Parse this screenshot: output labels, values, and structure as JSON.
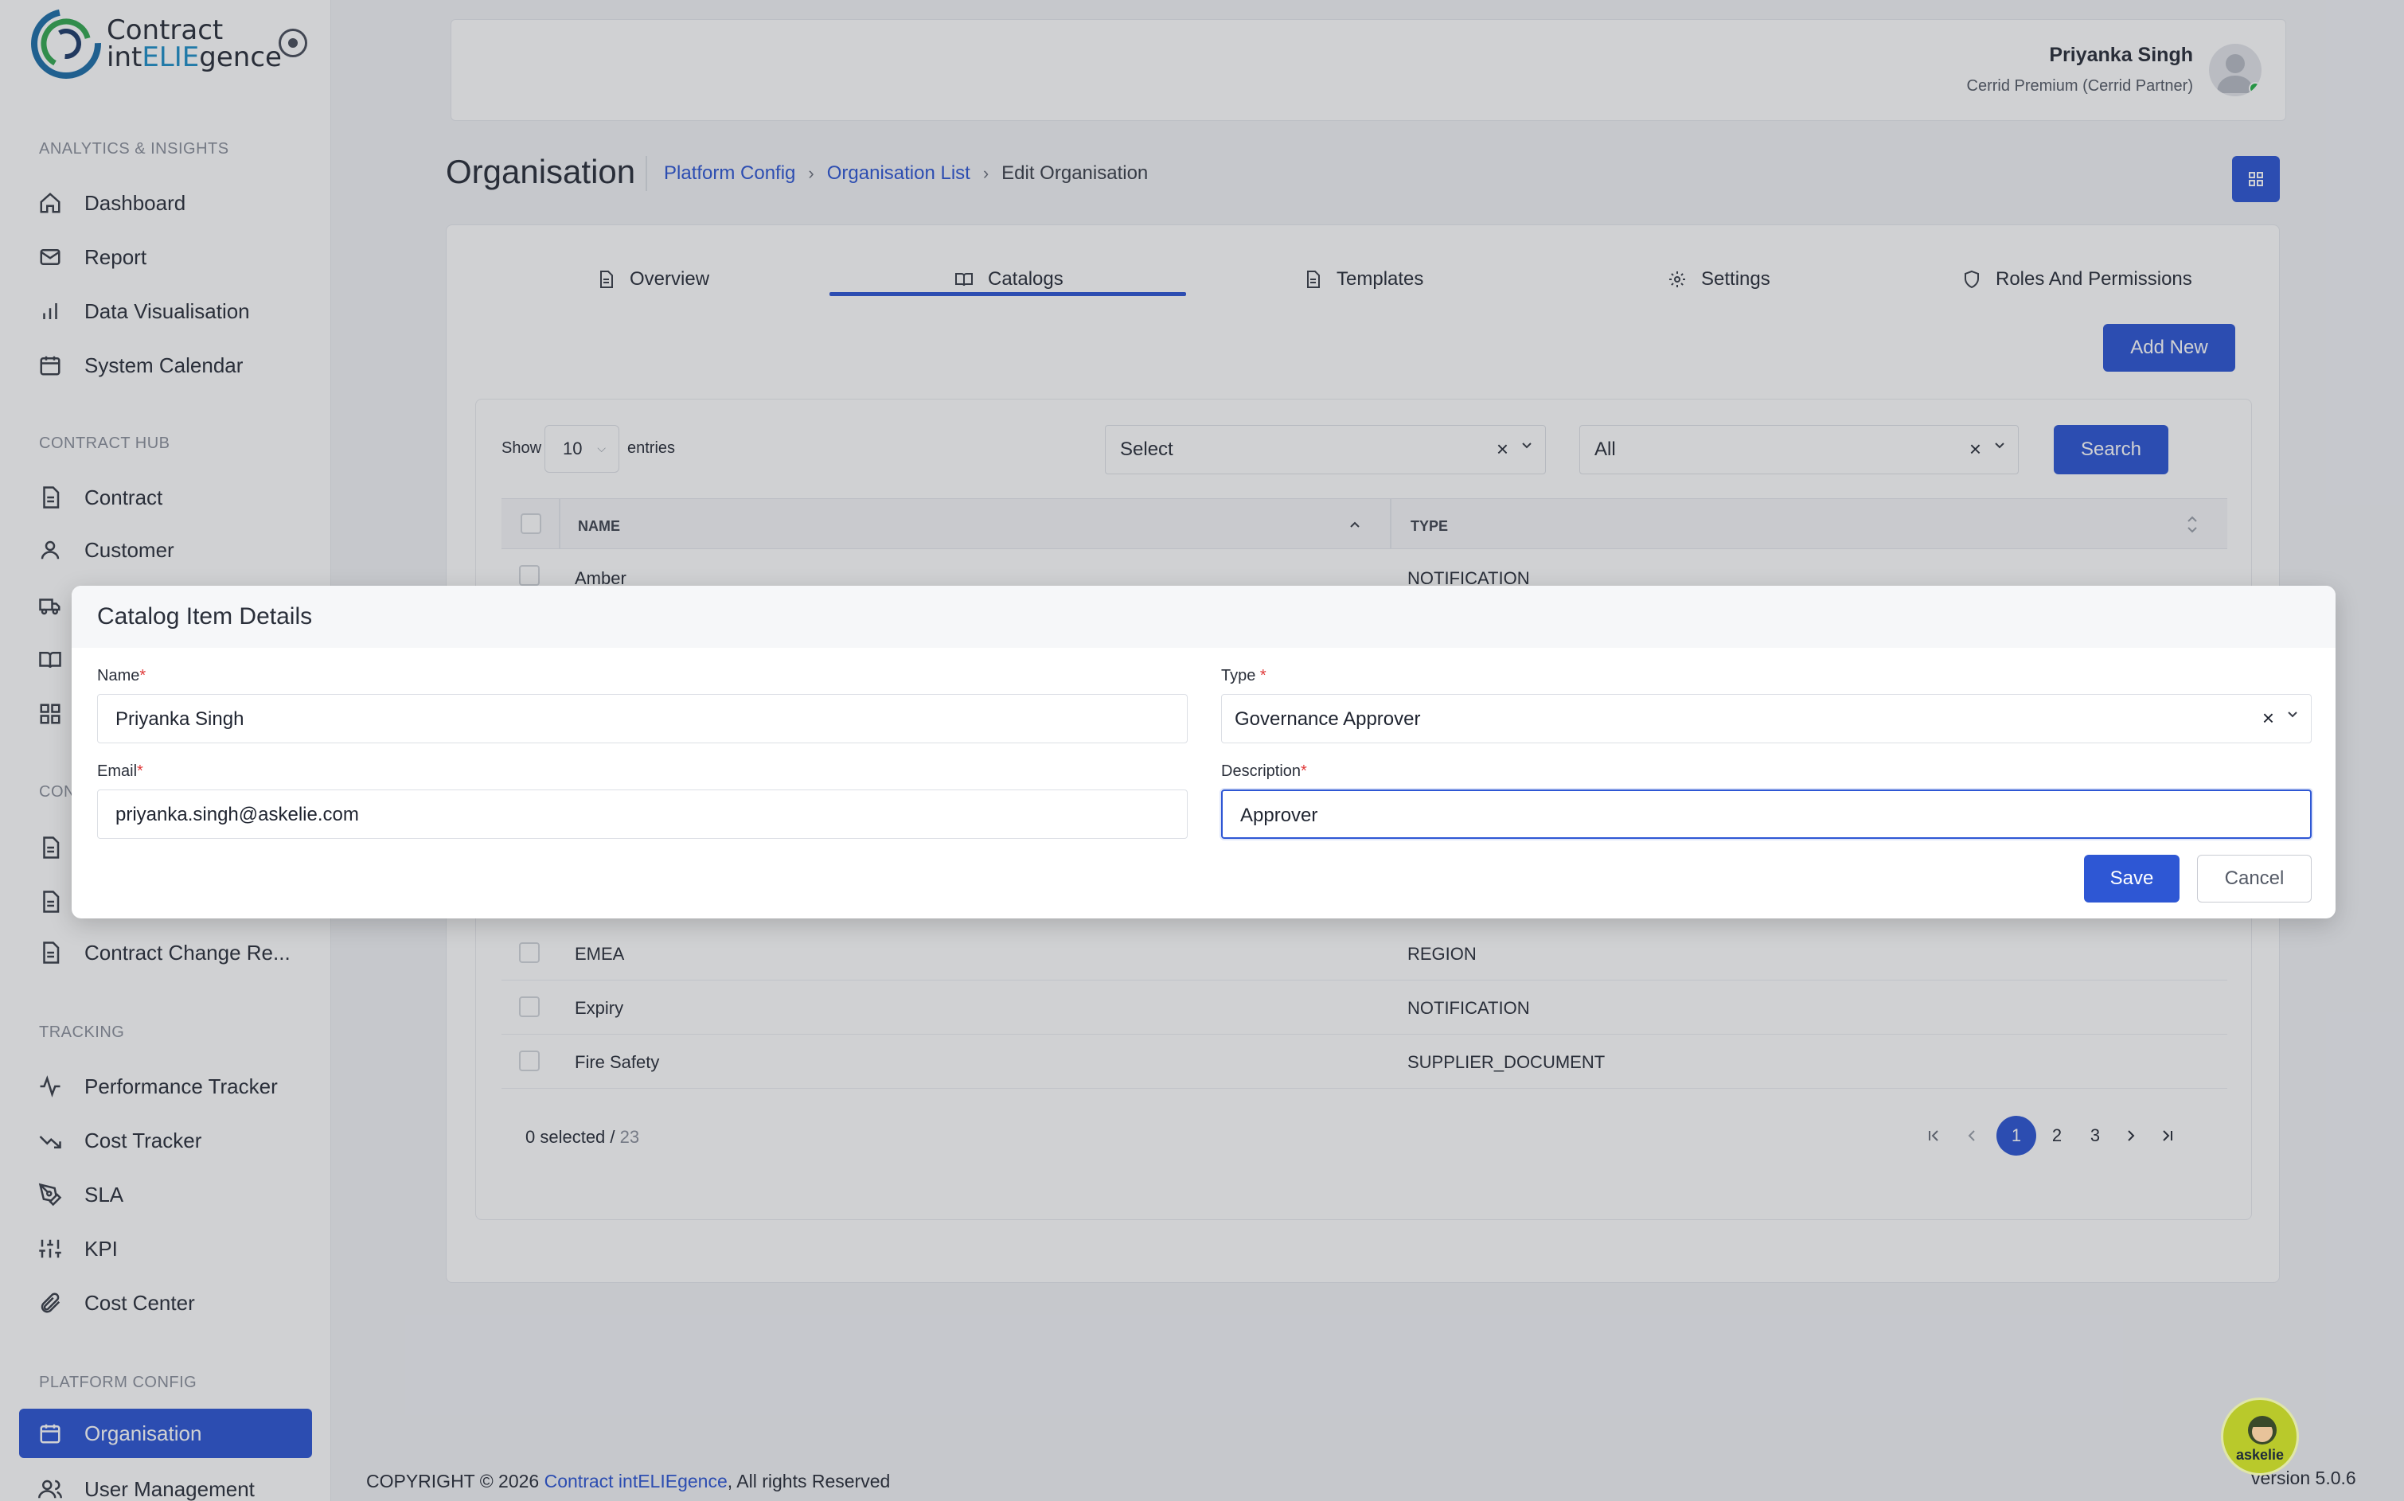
{
  "brand": {
    "name_line1": "Contract",
    "name_line2_pre": "int",
    "name_line2_accent": "ELIE",
    "name_line2_post": "gence"
  },
  "sidebar": {
    "sections": [
      {
        "title": "ANALYTICS & INSIGHTS"
      },
      {
        "title": "CONTRACT HUB"
      },
      {
        "title": "CON"
      },
      {
        "title": "TRACKING"
      },
      {
        "title": "PLATFORM CONFIG"
      }
    ],
    "items": [
      {
        "label": "Dashboard",
        "icon": "home-icon"
      },
      {
        "label": "Report",
        "icon": "mail-icon"
      },
      {
        "label": "Data Visualisation",
        "icon": "bar-chart-icon"
      },
      {
        "label": "System Calendar",
        "icon": "calendar-icon"
      },
      {
        "label": "Contract",
        "icon": "document-icon"
      },
      {
        "label": "Customer",
        "icon": "user-icon"
      },
      {
        "label": "",
        "icon": "truck-icon"
      },
      {
        "label": "",
        "icon": "book-icon"
      },
      {
        "label": "",
        "icon": "grid-icon"
      },
      {
        "label": "",
        "icon": "document-icon"
      },
      {
        "label": "",
        "icon": "document-icon"
      },
      {
        "label": "Contract Change Re...",
        "icon": "document-icon"
      },
      {
        "label": "Performance Tracker",
        "icon": "activity-icon"
      },
      {
        "label": "Cost Tracker",
        "icon": "trend-down-icon"
      },
      {
        "label": "SLA",
        "icon": "pen-tool-icon"
      },
      {
        "label": "KPI",
        "icon": "sliders-icon"
      },
      {
        "label": "Cost Center",
        "icon": "paperclip-icon"
      },
      {
        "label": "Organisation",
        "icon": "calendar-icon"
      },
      {
        "label": "User Management",
        "icon": "users-icon"
      }
    ]
  },
  "header": {
    "user_name": "Priyanka Singh",
    "user_role": "Cerrid Premium (Cerrid Partner)"
  },
  "page": {
    "title": "Organisation",
    "breadcrumb": [
      "Platform Config",
      "Organisation List",
      "Edit Organisation"
    ],
    "tabs": [
      "Overview",
      "Catalogs",
      "Templates",
      "Settings",
      "Roles And Permissions"
    ],
    "add_new": "Add New"
  },
  "table_controls": {
    "show_label": "Show",
    "entries_value": "10",
    "entries_label": "entries",
    "filter1": "Select",
    "filter2": "All",
    "search_label": "Search"
  },
  "table": {
    "columns": [
      "NAME",
      "TYPE"
    ],
    "rows": [
      {
        "name": "Amber",
        "type": "NOTIFICATION"
      },
      {
        "name": "EMEA",
        "type": "REGION"
      },
      {
        "name": "Expiry",
        "type": "NOTIFICATION"
      },
      {
        "name": "Fire Safety",
        "type": "SUPPLIER_DOCUMENT"
      }
    ],
    "selected_text": "0 selected / ",
    "total": "23",
    "pages": [
      "1",
      "2",
      "3"
    ]
  },
  "modal": {
    "title": "Catalog Item Details",
    "name_label": "Name",
    "name_value": "Priyanka Singh",
    "type_label": "Type",
    "type_value": "Governance Approver",
    "email_label": "Email",
    "email_value": "priyanka.singh@askelie.com",
    "description_label": "Description",
    "description_value": "Approver",
    "required_mark": "*",
    "save_label": "Save",
    "cancel_label": "Cancel"
  },
  "footer": {
    "copyright": "COPYRIGHT © 2026 ",
    "brand_link": "Contract intELIEgence",
    "suffix": ", All rights Reserved",
    "version": "version 5.0.6"
  },
  "assistant": {
    "label": "askelie"
  },
  "colors": {
    "primary": "#2e57d4",
    "required": "#e03a3a",
    "online": "#26b24a"
  }
}
